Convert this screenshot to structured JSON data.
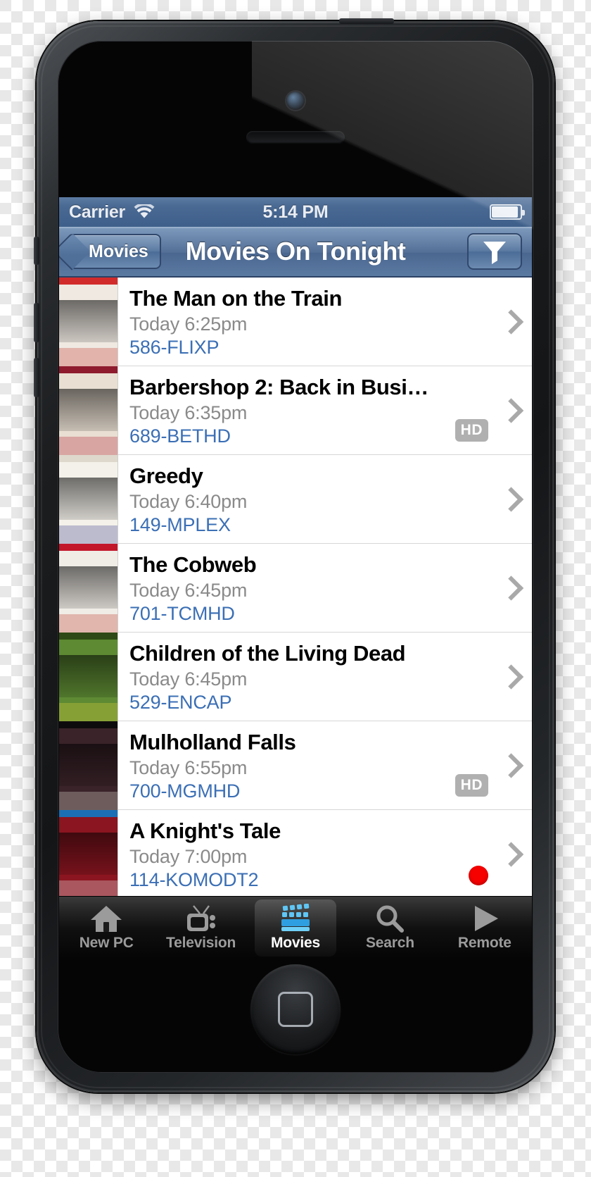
{
  "status_bar": {
    "carrier": "Carrier",
    "wifi_icon": "wifi-icon",
    "time": "5:14 PM",
    "battery_icon": "battery-icon"
  },
  "nav_bar": {
    "back_label": "Movies",
    "title": "Movies On Tonight",
    "filter_icon": "funnel-filter-icon"
  },
  "colors": {
    "nav_blue": "#4a6790",
    "status_blue": "#3e5f8a",
    "channel_link": "#3b6fb5",
    "subtitle_gray": "#8a8a8a",
    "hd_badge_gray": "#b0b0b0",
    "record_dot_red": "#f60000",
    "tab_active_white": "#ffffff",
    "tab_inactive_gray": "#9b9b9b"
  },
  "listings": [
    {
      "title": "The Man on the Train",
      "time": "Today 6:25pm",
      "channel": "586-FLIXP",
      "hd": false,
      "recording": false,
      "hd_label": "HD",
      "poster": {
        "bg": "#efe9e2",
        "band": "#d22b2b",
        "text": "#c0392b"
      }
    },
    {
      "title": "Barbershop 2: Back in Busi…",
      "time": "Today 6:35pm",
      "channel": "689-BETHD",
      "hd": true,
      "recording": false,
      "hd_label": "HD",
      "poster": {
        "bg": "#e9dfd2",
        "band": "#8e1b2e",
        "text": "#b22234"
      }
    },
    {
      "title": "Greedy",
      "time": "Today 6:40pm",
      "channel": "149-MPLEX",
      "hd": false,
      "recording": false,
      "hd_label": "HD",
      "poster": {
        "bg": "#f4f1ea",
        "band": "#ded8cc",
        "text": "#3c3f8f"
      }
    },
    {
      "title": "The Cobweb",
      "time": "Today 6:45pm",
      "channel": "701-TCMHD",
      "hd": false,
      "recording": false,
      "hd_label": "HD",
      "poster": {
        "bg": "#f0ece6",
        "band": "#c3162a",
        "text": "#c0392b"
      }
    },
    {
      "title": "Children of the Living Dead",
      "time": "Today 6:45pm",
      "channel": "529-ENCAP",
      "hd": false,
      "recording": false,
      "hd_label": "HD",
      "poster": {
        "bg": "#5d8a33",
        "band": "#2f4a16",
        "text": "#e8d43a"
      }
    },
    {
      "title": "Mulholland Falls",
      "time": "Today 6:55pm",
      "channel": "700-MGMHD",
      "hd": true,
      "recording": false,
      "hd_label": "HD",
      "poster": {
        "bg": "#3a2329",
        "band": "#0e0b0c",
        "text": "#e8e2d8"
      }
    },
    {
      "title": "A Knight's Tale",
      "time": "Today 7:00pm",
      "channel": "114-KOMODT2",
      "hd": false,
      "recording": true,
      "hd_label": "HD",
      "poster": {
        "bg": "#8b1520",
        "band": "#1c6fb5",
        "text": "#f2f2f2"
      }
    }
  ],
  "tab_bar": {
    "items": [
      {
        "label": "New PC",
        "icon": "home-icon",
        "active": false
      },
      {
        "label": "Television",
        "icon": "tv-icon",
        "active": false
      },
      {
        "label": "Movies",
        "icon": "clapboard-icon",
        "active": true
      },
      {
        "label": "Search",
        "icon": "search-icon",
        "active": false
      },
      {
        "label": "Remote",
        "icon": "play-icon",
        "active": false
      }
    ]
  }
}
